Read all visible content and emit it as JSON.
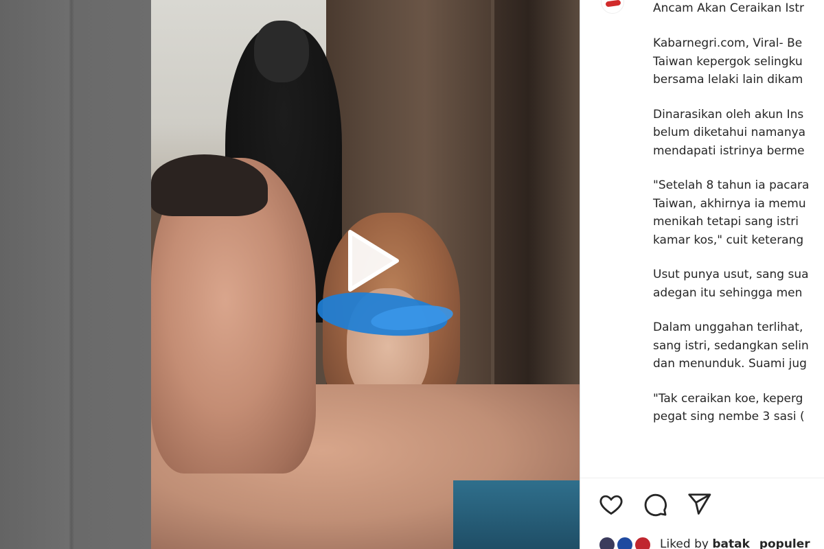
{
  "post": {
    "headline": "Ancam Akan Ceraikan Istr",
    "caption_paragraphs": [
      [
        "Kabarnegri.com, Viral- Be",
        "Taiwan kepergok selingku",
        "bersama lelaki lain dikam"
      ],
      [
        "Dinarasikan oleh akun Ins",
        "belum diketahui namanya",
        "mendapati istrinya berme"
      ],
      [
        "\"Setelah 8 tahun ia pacara",
        "Taiwan, akhirnya ia memu",
        "menikah tetapi sang istri",
        "kamar kos,\" cuit keterang"
      ],
      [
        "Usut punya usut, sang sua",
        "adegan itu sehingga men"
      ],
      [
        "Dalam unggahan terlihat,",
        "sang istri, sedangkan selin",
        "dan menunduk. Suami jug"
      ],
      [
        "\"Tak ceraikan koe, keperg",
        "pegat sing nembe 3 sasi ("
      ]
    ],
    "actions": [
      "like-icon",
      "comment-icon",
      "share-icon"
    ],
    "likes": {
      "prefix": "Liked by",
      "user": "batak_",
      "suffix": "populer"
    }
  },
  "video": {
    "play_icon": "play-icon",
    "overlay_color": "#1e7fd6"
  }
}
